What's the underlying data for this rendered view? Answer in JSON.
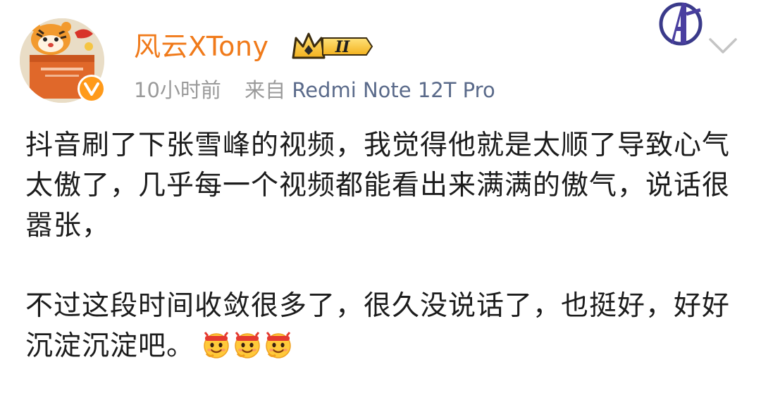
{
  "user": {
    "name": "风云XTony",
    "level_badge": "II"
  },
  "meta": {
    "time": "10小时前",
    "source_prefix": "来自",
    "device": "Redmi Note 12T Pro"
  },
  "post": {
    "paragraph1": "抖音刷了下张雪峰的视频，我觉得他就是太顺了导致心气太傲了，几乎每一个视频都能看出来满满的傲气，说话很嚣张，",
    "paragraph2": "不过这段时间收敛很多了，很久没说话了，也挺好，好好沉淀沉淀吧。",
    "emojis": [
      "smile-headband-emoji",
      "smile-headband-emoji",
      "smile-headband-emoji"
    ]
  },
  "colors": {
    "username": "#f07a1a",
    "meta": "#9a9a9a",
    "device": "#5a6a8a",
    "verified": "#ff9a1a"
  },
  "icons": {
    "avatar": "tiger-avatar",
    "verified": "verified-v-icon",
    "logo": "avengers-logo-icon",
    "more": "chevron-down-icon"
  }
}
